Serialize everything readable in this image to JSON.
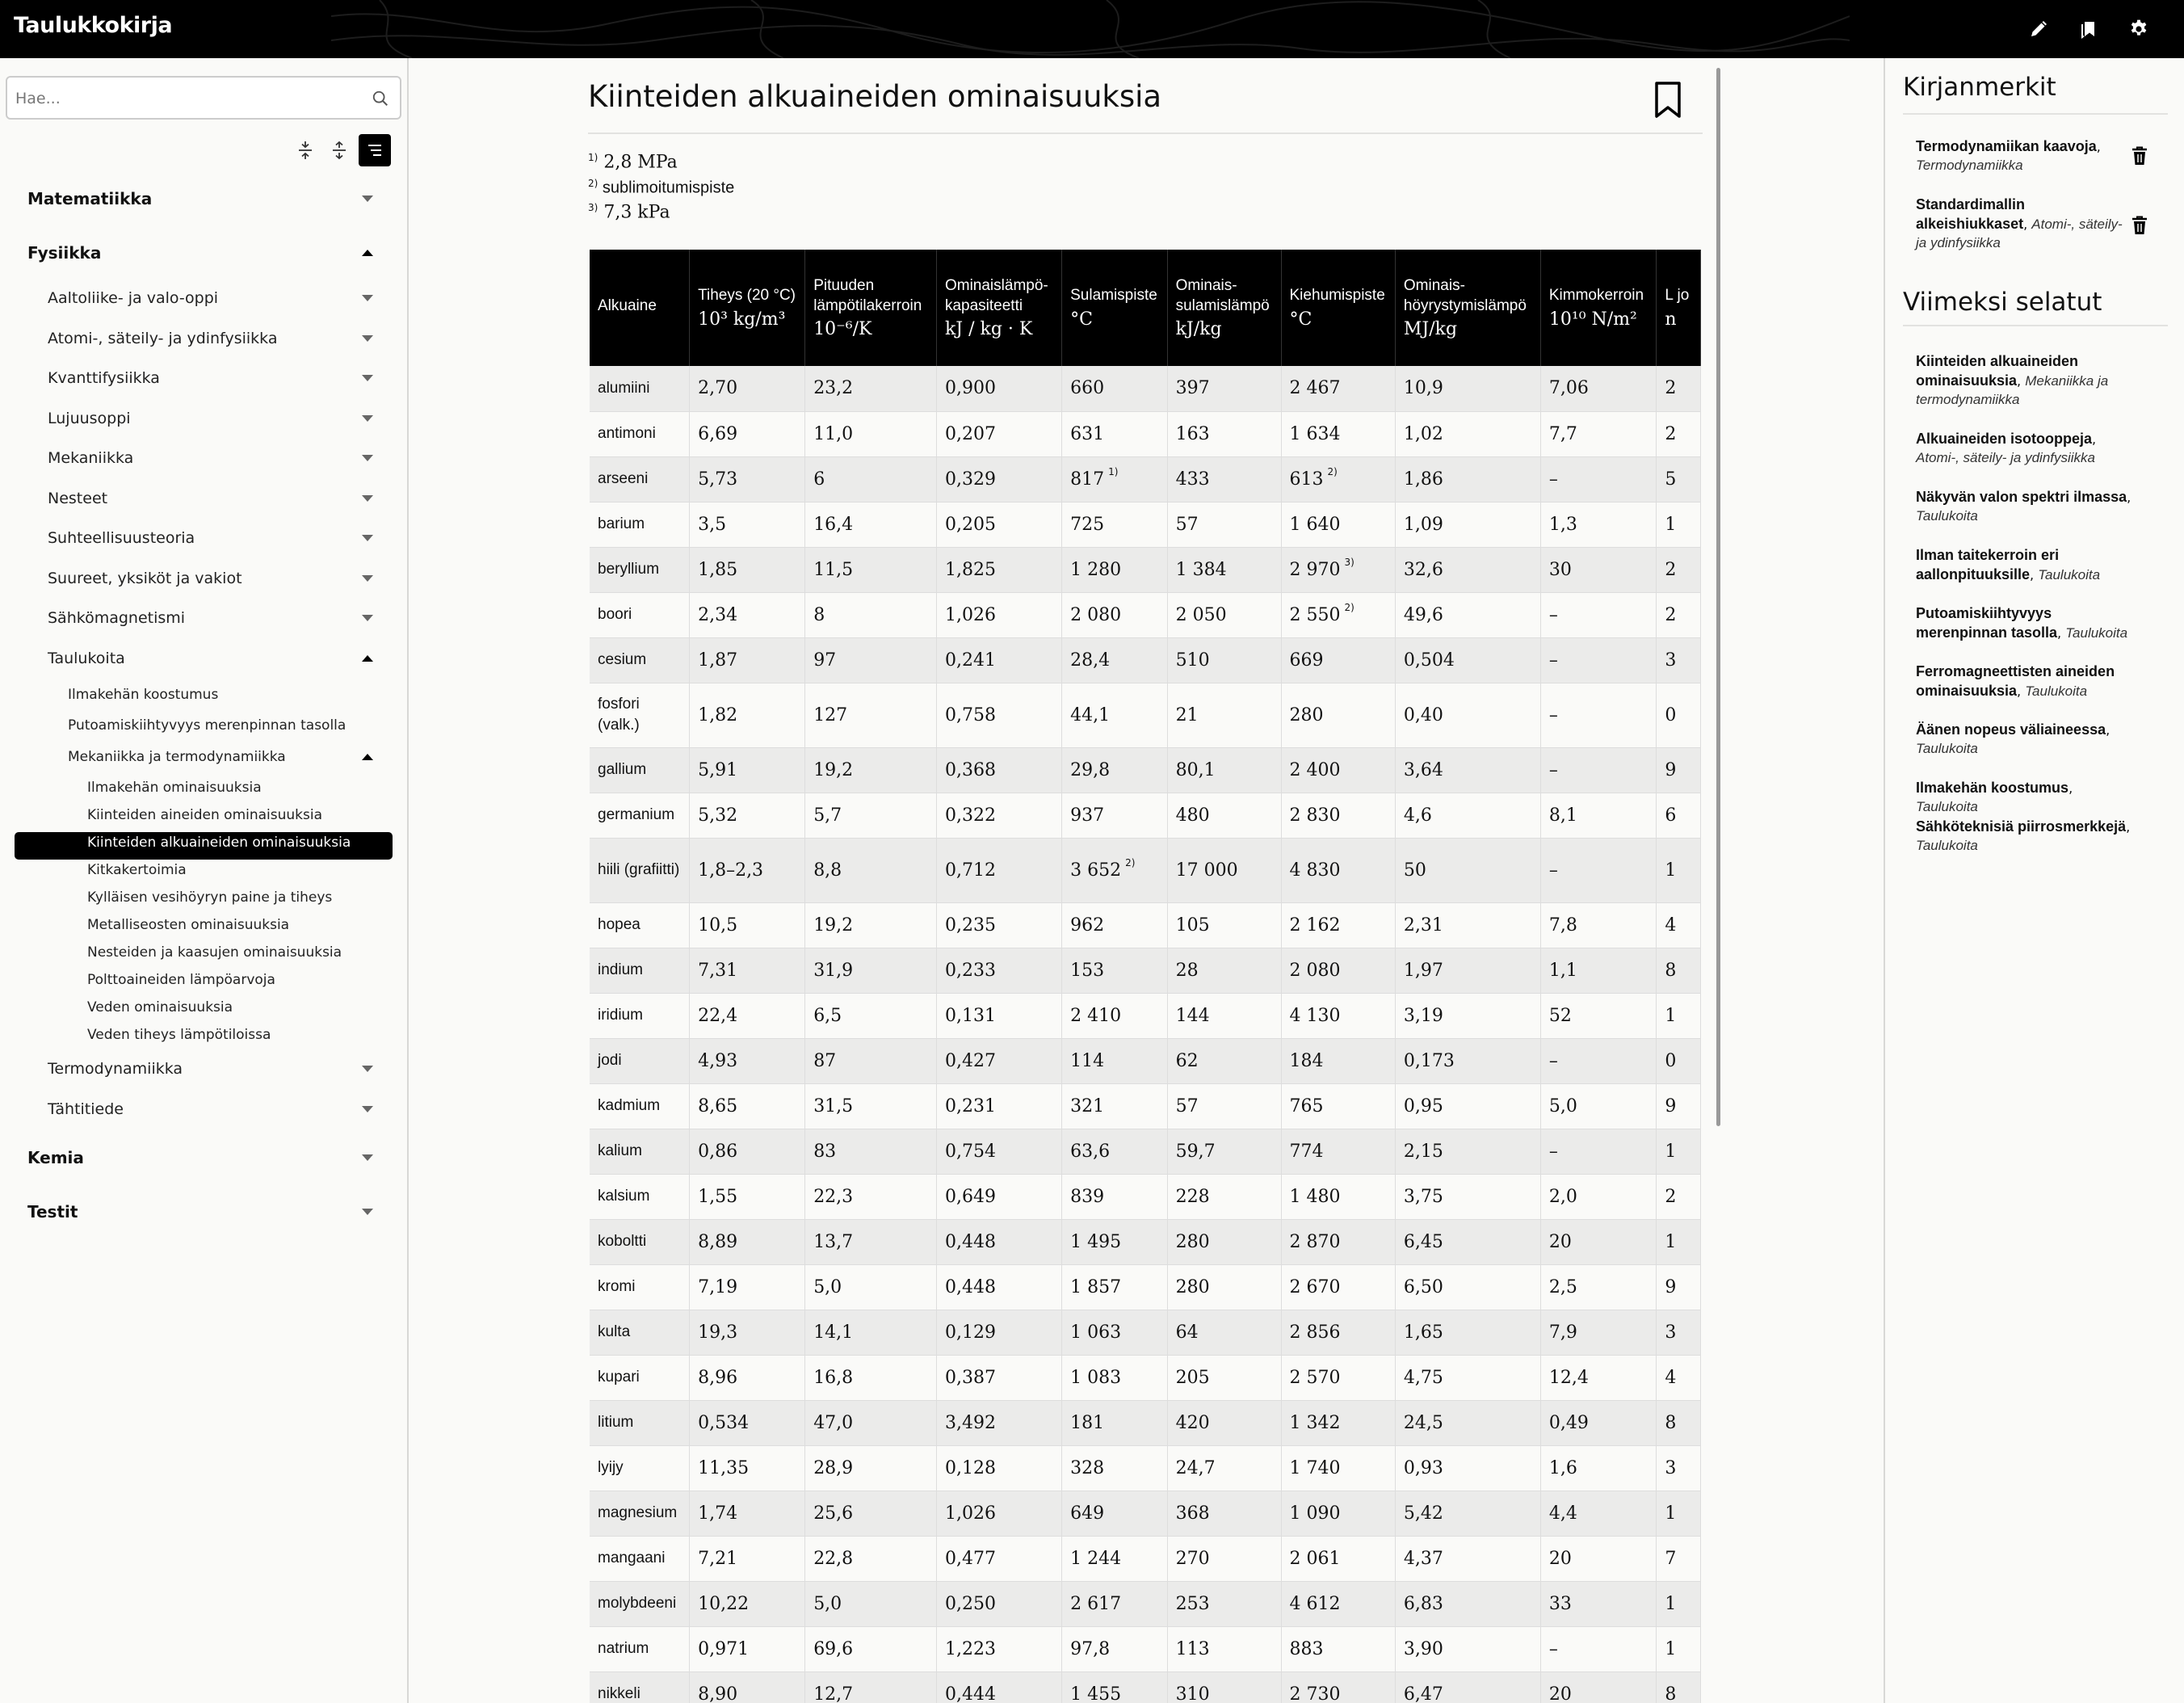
{
  "app": {
    "title": "Taulukkokirja"
  },
  "toolbar": {
    "icons": [
      "pencil-icon",
      "bookmarks-icon",
      "gear-icon"
    ]
  },
  "search": {
    "placeholder": "Hae...",
    "value": ""
  },
  "sidebar": {
    "view_buttons": [
      "collapse-all-icon",
      "expand-all-icon",
      "list-view-icon"
    ],
    "nav": [
      {
        "label": "Matematiikka",
        "level": 0,
        "state": "collapsed"
      },
      {
        "label": "Fysiikka",
        "level": 0,
        "state": "expanded"
      },
      {
        "label": "Aaltoliike- ja valo-oppi",
        "level": 1,
        "state": "collapsed"
      },
      {
        "label": "Atomi-, säteily- ja ydinfysiikka",
        "level": 1,
        "state": "collapsed"
      },
      {
        "label": "Kvanttifysiikka",
        "level": 1,
        "state": "collapsed"
      },
      {
        "label": "Lujuusoppi",
        "level": 1,
        "state": "collapsed"
      },
      {
        "label": "Mekaniikka",
        "level": 1,
        "state": "collapsed"
      },
      {
        "label": "Nesteet",
        "level": 1,
        "state": "collapsed"
      },
      {
        "label": "Suhteellisuusteoria",
        "level": 1,
        "state": "collapsed"
      },
      {
        "label": "Suureet, yksiköt ja vakiot",
        "level": 1,
        "state": "collapsed"
      },
      {
        "label": "Sähkömagnetismi",
        "level": 1,
        "state": "collapsed"
      },
      {
        "label": "Taulukoita",
        "level": 1,
        "state": "expanded"
      },
      {
        "label": "Ilmakehän koostumus",
        "level": 2,
        "state": "leaf"
      },
      {
        "label": "Putoamiskiihtyvyys merenpinnan tasolla",
        "level": 2,
        "state": "leaf"
      },
      {
        "label": "Mekaniikka ja termodynamiikka",
        "level": 2,
        "state": "expanded"
      },
      {
        "label": "Ilmakehän ominaisuuksia",
        "level": 3,
        "state": "leaf"
      },
      {
        "label": "Kiinteiden aineiden ominaisuuksia",
        "level": 3,
        "state": "leaf"
      },
      {
        "label": "Kiinteiden alkuaineiden ominaisuuksia",
        "level": 3,
        "state": "active"
      },
      {
        "label": "Kitkakertoimia",
        "level": 3,
        "state": "leaf"
      },
      {
        "label": "Kylläisen vesihöyryn paine ja tiheys",
        "level": 3,
        "state": "leaf"
      },
      {
        "label": "Metalliseosten ominaisuuksia",
        "level": 3,
        "state": "leaf"
      },
      {
        "label": "Nesteiden ja kaasujen ominaisuuksia",
        "level": 3,
        "state": "leaf"
      },
      {
        "label": "Polttoaineiden lämpöarvoja",
        "level": 3,
        "state": "leaf"
      },
      {
        "label": "Veden ominaisuuksia",
        "level": 3,
        "state": "leaf"
      },
      {
        "label": "Veden tiheys lämpötiloissa",
        "level": 3,
        "state": "leaf"
      },
      {
        "label": "Termodynamiikka",
        "level": 1,
        "state": "collapsed"
      },
      {
        "label": "Tähtitiede",
        "level": 1,
        "state": "collapsed"
      },
      {
        "label": "Kemia",
        "level": 0,
        "state": "collapsed"
      },
      {
        "label": "Testit",
        "level": 0,
        "state": "collapsed"
      }
    ]
  },
  "main": {
    "title": "Kiinteiden alkuaineiden ominaisuuksia",
    "footnotes": [
      {
        "mark": "1)",
        "text": "2,8 MPa"
      },
      {
        "mark": "2)",
        "text": "sublimoitumispiste"
      },
      {
        "mark": "3)",
        "text": "7,3 kPa"
      }
    ],
    "table": {
      "headers": [
        {
          "label": "Alkuaine",
          "unit": ""
        },
        {
          "label": "Tiheys (20 °C)",
          "unit": "10³ kg/m³"
        },
        {
          "label": "Pituuden lämpötilakerroin",
          "unit": "10⁻⁶/K"
        },
        {
          "label": "Ominaislämpö-kapasiteetti",
          "unit": "kJ / kg · K"
        },
        {
          "label": "Sulamispiste",
          "unit": "°C"
        },
        {
          "label": "Ominais-sulamislämpö",
          "unit": "kJ/kg"
        },
        {
          "label": "Kiehumispiste",
          "unit": "°C"
        },
        {
          "label": "Ominais-höyrystymislämpö",
          "unit": "MJ/kg"
        },
        {
          "label": "Kimmokerroin",
          "unit": "10¹⁰ N/m²"
        },
        {
          "label": "L jo",
          "unit": "n"
        }
      ],
      "rows": [
        [
          "alumiini",
          "2,70",
          "23,2",
          "0,900",
          "660",
          "397",
          "2 467",
          "10,9",
          "7,06",
          "2"
        ],
        [
          "antimoni",
          "6,69",
          "11,0",
          "0,207",
          "631",
          "163",
          "1 634",
          "1,02",
          "7,7",
          "2"
        ],
        [
          "arseeni",
          "5,73",
          "6",
          "0,329",
          "817|1)",
          "433",
          "613|2)",
          "1,86",
          "–",
          "5"
        ],
        [
          "barium",
          "3,5",
          "16,4",
          "0,205",
          "725",
          "57",
          "1 640",
          "1,09",
          "1,3",
          "1"
        ],
        [
          "beryllium",
          "1,85",
          "11,5",
          "1,825",
          "1 280",
          "1 384",
          "2 970|3)",
          "32,6",
          "30",
          "2"
        ],
        [
          "boori",
          "2,34",
          "8",
          "1,026",
          "2 080",
          "2 050",
          "2 550|2)",
          "49,6",
          "–",
          "2"
        ],
        [
          "cesium",
          "1,87",
          "97",
          "0,241",
          "28,4",
          "510",
          "669",
          "0,504",
          "–",
          "3"
        ],
        [
          "fosfori (valk.)",
          "1,82",
          "127",
          "0,758",
          "44,1",
          "21",
          "280",
          "0,40",
          "–",
          "0"
        ],
        [
          "gallium",
          "5,91",
          "19,2",
          "0,368",
          "29,8",
          "80,1",
          "2 400",
          "3,64",
          "–",
          "9"
        ],
        [
          "germanium",
          "5,32",
          "5,7",
          "0,322",
          "937",
          "480",
          "2 830",
          "4,6",
          "8,1",
          "6"
        ],
        [
          "hiili (grafiitti)",
          "1,8–2,3",
          "8,8",
          "0,712",
          "3 652|2)",
          "17 000",
          "4 830",
          "50",
          "–",
          "1"
        ],
        [
          "hopea",
          "10,5",
          "19,2",
          "0,235",
          "962",
          "105",
          "2 162",
          "2,31",
          "7,8",
          "4"
        ],
        [
          "indium",
          "7,31",
          "31,9",
          "0,233",
          "153",
          "28",
          "2 080",
          "1,97",
          "1,1",
          "8"
        ],
        [
          "iridium",
          "22,4",
          "6,5",
          "0,131",
          "2 410",
          "144",
          "4 130",
          "3,19",
          "52",
          "1"
        ],
        [
          "jodi",
          "4,93",
          "87",
          "0,427",
          "114",
          "62",
          "184",
          "0,173",
          "–",
          "0"
        ],
        [
          "kadmium",
          "8,65",
          "31,5",
          "0,231",
          "321",
          "57",
          "765",
          "0,95",
          "5,0",
          "9"
        ],
        [
          "kalium",
          "0,86",
          "83",
          "0,754",
          "63,6",
          "59,7",
          "774",
          "2,15",
          "–",
          "1"
        ],
        [
          "kalsium",
          "1,55",
          "22,3",
          "0,649",
          "839",
          "228",
          "1 480",
          "3,75",
          "2,0",
          "2"
        ],
        [
          "koboltti",
          "8,89",
          "13,7",
          "0,448",
          "1 495",
          "280",
          "2 870",
          "6,45",
          "20",
          "1"
        ],
        [
          "kromi",
          "7,19",
          "5,0",
          "0,448",
          "1 857",
          "280",
          "2 670",
          "6,50",
          "2,5",
          "9"
        ],
        [
          "kulta",
          "19,3",
          "14,1",
          "0,129",
          "1 063",
          "64",
          "2 856",
          "1,65",
          "7,9",
          "3"
        ],
        [
          "kupari",
          "8,96",
          "16,8",
          "0,387",
          "1 083",
          "205",
          "2 570",
          "4,75",
          "12,4",
          "4"
        ],
        [
          "litium",
          "0,534",
          "47,0",
          "3,492",
          "181",
          "420",
          "1 342",
          "24,5",
          "0,49",
          "8"
        ],
        [
          "lyijy",
          "11,35",
          "28,9",
          "0,128",
          "328",
          "24,7",
          "1 740",
          "0,93",
          "1,6",
          "3"
        ],
        [
          "magnesium",
          "1,74",
          "25,6",
          "1,026",
          "649",
          "368",
          "1 090",
          "5,42",
          "4,4",
          "1"
        ],
        [
          "mangaani",
          "7,21",
          "22,8",
          "0,477",
          "1 244",
          "270",
          "2 061",
          "4,37",
          "20",
          "7"
        ],
        [
          "molybdeeni",
          "10,22",
          "5,0",
          "0,250",
          "2 617",
          "253",
          "4 612",
          "6,83",
          "33",
          "1"
        ],
        [
          "natrium",
          "0,971",
          "69,6",
          "1,223",
          "97,8",
          "113",
          "883",
          "3,90",
          "–",
          "1"
        ],
        [
          "nikkeli",
          "8,90",
          "12,7",
          "0,444",
          "1 455",
          "310",
          "2 730",
          "6,47",
          "20",
          "8"
        ]
      ]
    }
  },
  "right_panel": {
    "bookmarks_heading": "Kirjanmerkit",
    "bookmarks": [
      {
        "title": "Termodynamiikan kaavoja",
        "category": "Termodynamiikka"
      },
      {
        "title": "Standardimallin alkeishiukkaset",
        "category": "Atomi-, säteily- ja ydinfysiikka"
      }
    ],
    "recent_heading": "Viimeksi selatut",
    "recent": [
      {
        "title": "Kiinteiden alkuaineiden ominaisuuksia",
        "category": "Mekaniikka ja termodynamiikka"
      },
      {
        "title": "Alkuaineiden isotooppeja",
        "category": "Atomi-, säteily- ja ydinfysiikka"
      },
      {
        "title": "Näkyvän valon spektri ilmassa",
        "category": "Taulukoita"
      },
      {
        "title": "Ilman taitekerroin eri aallonpituuksille",
        "category": "Taulukoita"
      },
      {
        "title": "Putoamiskiihtyvyys merenpinnan tasolla",
        "category": "Taulukoita"
      },
      {
        "title": "Ferromagneettisten aineiden ominaisuuksia",
        "category": "Taulukoita"
      },
      {
        "title": "Äänen nopeus väliaineessa",
        "category": "Taulukoita"
      },
      {
        "title": "Ilmakehän koostumus",
        "category": "Taulukoita"
      },
      {
        "title": "Sähköteknisiä piirrosmerkkejä",
        "category": "Taulukoita"
      }
    ]
  }
}
